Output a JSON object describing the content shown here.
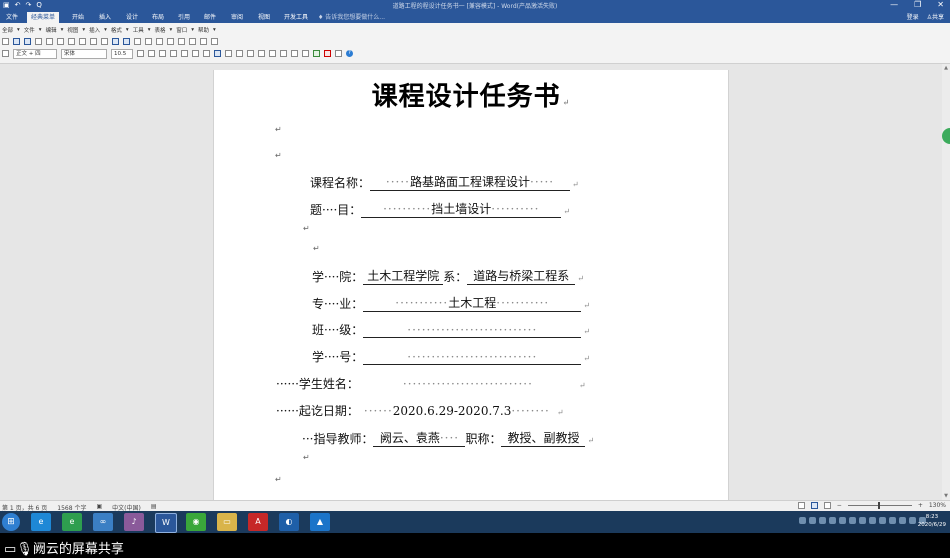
{
  "window": {
    "title": "道路工程的程设计任务书一 [兼容模式] - Word(产品激活失败)",
    "quick_access": [
      "▣",
      "↶",
      "↷",
      "Q"
    ],
    "controls": [
      "—",
      "❐",
      "✕"
    ]
  },
  "menu": {
    "tabs": [
      "文件",
      "经典菜单",
      "开始",
      "插入",
      "设计",
      "布局",
      "引用",
      "邮件",
      "审阅",
      "视图",
      "开发工具"
    ],
    "active_index": 1,
    "tell_me": "告诉我您想要做什么...",
    "login": "登录",
    "share": "共享"
  },
  "ribbon": {
    "classic_menus": [
      "全部",
      "文件",
      "编辑",
      "视图",
      "插入",
      "格式",
      "工具",
      "表格",
      "窗口",
      "帮助"
    ],
    "font_style": "正文 + 四",
    "font_name": "宋体",
    "font_size": "10.5"
  },
  "document": {
    "title": "课程设计任务书",
    "fields": [
      {
        "label": "课程名称：",
        "value": "路基路面工程课程设计"
      },
      {
        "label": "题····目：",
        "value": "挡土墙设计"
      },
      {
        "label": "学····院：",
        "value": "土木工程学院",
        "label2": "系：",
        "value2": "道路与桥梁工程系"
      },
      {
        "label": "专····业：",
        "value": "土木工程"
      },
      {
        "label": "班····级：",
        "value": ""
      },
      {
        "label": "学····号：",
        "value": ""
      },
      {
        "label": "······学生姓名：",
        "value": ""
      },
      {
        "label": "······起讫日期：",
        "value": "2020.6.29-2020.7.3"
      },
      {
        "label": "···指导教师：",
        "value": "阙云、袁燕",
        "label2": "职称：",
        "value2": "教授、副教授"
      }
    ]
  },
  "status": {
    "page": "第 1 页，共 6 页",
    "words": "1568 个字",
    "language": "中文(中国)",
    "zoom": "130%"
  },
  "taskbar": {
    "time": "8:23",
    "date": "2020/6/29"
  },
  "share_caption": "阙云的屏幕共享"
}
